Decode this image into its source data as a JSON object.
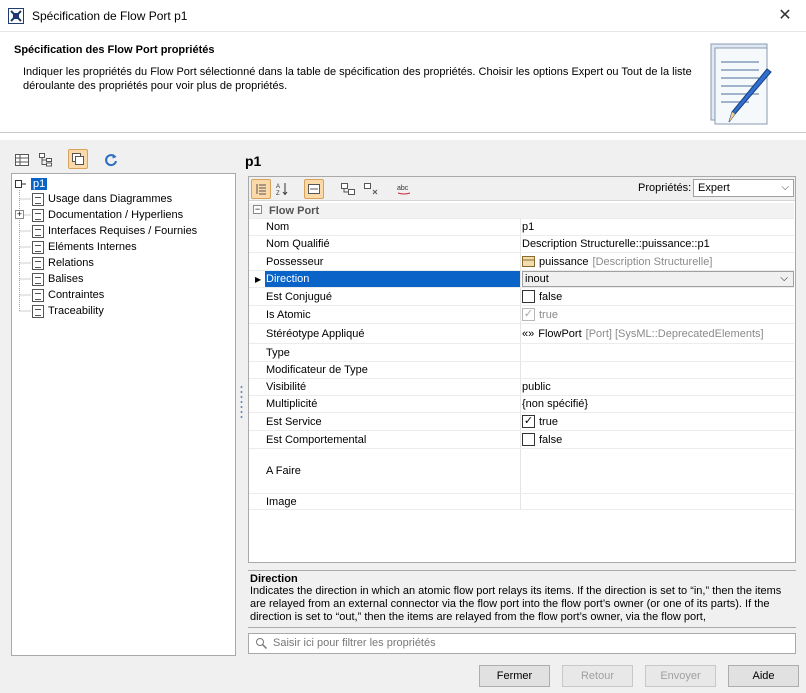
{
  "window": {
    "title": "Spécification de Flow Port p1",
    "close_label": "✕"
  },
  "header": {
    "title": "Spécification des Flow Port propriétés",
    "description": "Indiquer les propriétés du Flow Port sélectionné dans la table de spécification des propriétés. Choisir les options Expert ou Tout de la liste déroulante des propriétés pour voir plus de propriétés."
  },
  "tree": {
    "root": "p1",
    "items": [
      "Usage dans Diagrammes",
      "Documentation / Hyperliens",
      "Interfaces Requises / Fournies",
      "Eléments Internes",
      "Relations",
      "Balises",
      "Contraintes",
      "Traceability"
    ]
  },
  "panel": {
    "title": "p1",
    "properties_label": "Propriétés:",
    "properties_value": "Expert"
  },
  "grid": {
    "section": "Flow Port",
    "rows": [
      {
        "name": "Nom",
        "value": "p1"
      },
      {
        "name": "Nom Qualifié",
        "value": "Description Structurelle::puissance::p1"
      },
      {
        "name": "Possesseur",
        "value": "puissance",
        "extra": "[Description Structurelle]"
      },
      {
        "name": "Direction",
        "value": "inout"
      },
      {
        "name": "Est Conjugué",
        "value": "false"
      },
      {
        "name": "Is Atomic",
        "value": "true"
      },
      {
        "name": "Stéréotype Appliqué",
        "prefix": "«»",
        "value": "FlowPort",
        "extra": "[Port] [SysML::DeprecatedElements]"
      },
      {
        "name": "Type",
        "value": ""
      },
      {
        "name": "Modificateur de Type",
        "value": ""
      },
      {
        "name": "Visibilité",
        "value": "public"
      },
      {
        "name": "Multiplicité",
        "value": "{non spécifié}"
      },
      {
        "name": "Est Service",
        "value": "true"
      },
      {
        "name": "Est Comportemental",
        "value": "false"
      },
      {
        "name": "A Faire",
        "value": ""
      },
      {
        "name": "Image",
        "value": ""
      }
    ]
  },
  "description": {
    "title": "Direction",
    "text": "Indicates the direction in which an atomic flow port relays its items. If the direction is set to “in,” then the items are relayed from an external connector via the flow port into the flow port’s owner (or one of its parts). If the direction is set to “out,” then the items are relayed from the flow port’s owner, via the flow port,"
  },
  "filter": {
    "placeholder": "Saisir ici pour filtrer les propriétés"
  },
  "buttons": {
    "close": "Fermer",
    "back": "Retour",
    "send": "Envoyer",
    "help": "Aide"
  },
  "colors": {
    "selection": "#0a64c8",
    "active_tool": "#fcd9a8"
  },
  "icons": [
    "app-icon",
    "document-pen-icon",
    "table-view-icon",
    "tree-view-icon",
    "copy-icon",
    "refresh-icon",
    "categorized-icon",
    "sort-az-icon",
    "compact-icon",
    "expand-icon",
    "collapse-icon",
    "abc-icon",
    "search-icon"
  ]
}
